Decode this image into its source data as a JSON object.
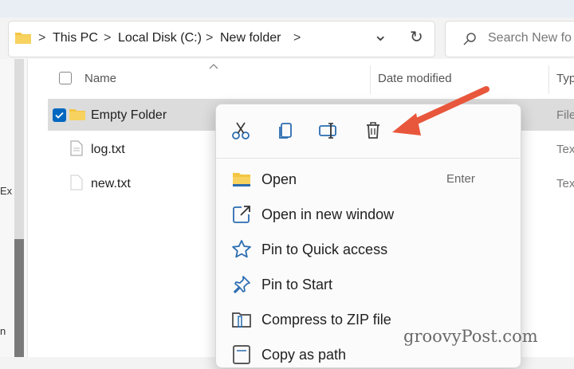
{
  "address": {
    "crumbs": [
      "This PC",
      "Local Disk (C:)",
      "New folder"
    ],
    "separator": ">",
    "expand_glyph": "⌄",
    "refresh_glyph": "↻"
  },
  "search": {
    "placeholder": "Search New fo"
  },
  "nav_fragments": {
    "a": "Ex",
    "b": "n"
  },
  "columns": {
    "name": "Name",
    "date": "Date modified",
    "type": "Typ"
  },
  "files": [
    {
      "name": "Empty Folder",
      "type": "File",
      "selected": true
    },
    {
      "name": "log.txt",
      "type": "Tex",
      "selected": false
    },
    {
      "name": "new.txt",
      "type": "Tex",
      "selected": false
    }
  ],
  "menu": {
    "top_actions": [
      "cut-icon",
      "copy-icon",
      "rename-icon",
      "delete-icon"
    ],
    "items": [
      {
        "label": "Open",
        "shortcut": "Enter",
        "icon": "folder-open-icon"
      },
      {
        "label": "Open in new window",
        "icon": "open-new-window-icon"
      },
      {
        "label": "Pin to Quick access",
        "icon": "star-icon"
      },
      {
        "label": "Pin to Start",
        "icon": "pin-icon"
      },
      {
        "label": "Compress to ZIP file",
        "icon": "zip-icon"
      },
      {
        "label": "Copy as path",
        "icon": "copy-path-icon"
      }
    ]
  },
  "watermark": "groovyPost.com",
  "colors": {
    "accent": "#0067c0",
    "folder": "#f4c542",
    "arrow": "#e8573c",
    "icon_blue": "#2b6cb0"
  }
}
